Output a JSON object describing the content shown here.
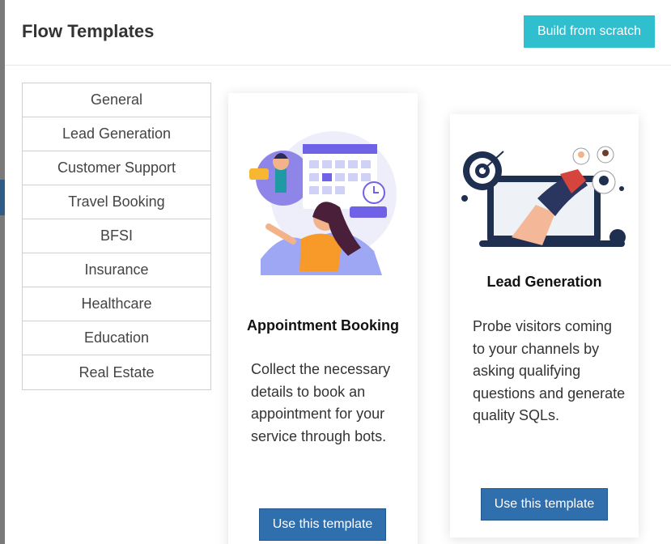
{
  "header": {
    "title": "Flow Templates",
    "build_button": "Build from scratch"
  },
  "categories": [
    {
      "label": "General"
    },
    {
      "label": "Lead Generation"
    },
    {
      "label": "Customer Support"
    },
    {
      "label": "Travel Booking"
    },
    {
      "label": "BFSI"
    },
    {
      "label": "Insurance"
    },
    {
      "label": "Healthcare"
    },
    {
      "label": "Education"
    },
    {
      "label": "Real Estate"
    }
  ],
  "templates": [
    {
      "title": "Appointment Booking",
      "description": "Collect the necessary details to book an appointment for your service through bots.",
      "button": "Use this template"
    },
    {
      "title": "Lead Generation",
      "description": "Probe visitors coming to your channels by asking qualifying questions and generate quality SQLs.",
      "button": "Use this template"
    }
  ],
  "colors": {
    "accent_teal": "#2fbfcf",
    "primary_blue": "#2f6fae"
  }
}
